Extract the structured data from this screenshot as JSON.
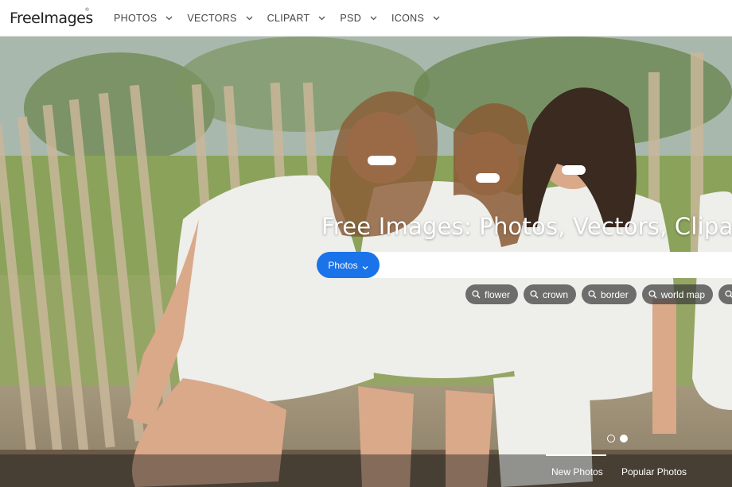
{
  "header": {
    "logo": "FreeImages",
    "logo_mark": "®",
    "nav": [
      {
        "label": "PHOTOS",
        "icon": "chevron-down-icon"
      },
      {
        "label": "VECTORS",
        "icon": "chevron-down-icon"
      },
      {
        "label": "CLIPART",
        "icon": "chevron-down-icon"
      },
      {
        "label": "PSD",
        "icon": "chevron-down-icon"
      },
      {
        "label": "ICONS",
        "icon": "chevron-down-icon"
      }
    ]
  },
  "hero": {
    "title": "Free Images: Photos, Vectors, Clipart, Ic",
    "search": {
      "type_label": "Photos",
      "placeholder": "",
      "value": ""
    },
    "tags": [
      {
        "label": "flower",
        "icon": "search-icon"
      },
      {
        "label": "crown",
        "icon": "search-icon"
      },
      {
        "label": "border",
        "icon": "search-icon"
      },
      {
        "label": "world map",
        "icon": "search-icon"
      }
    ],
    "carousel": {
      "slide_count": 2,
      "active_slide": 2
    },
    "bottom_tabs": [
      {
        "label": "New Photos",
        "active": true
      },
      {
        "label": "Popular Photos",
        "active": false
      }
    ]
  },
  "colors": {
    "accent": "#1a73e8",
    "header_bg": "#ffffff",
    "tag_bg": "#3c3c3c"
  }
}
